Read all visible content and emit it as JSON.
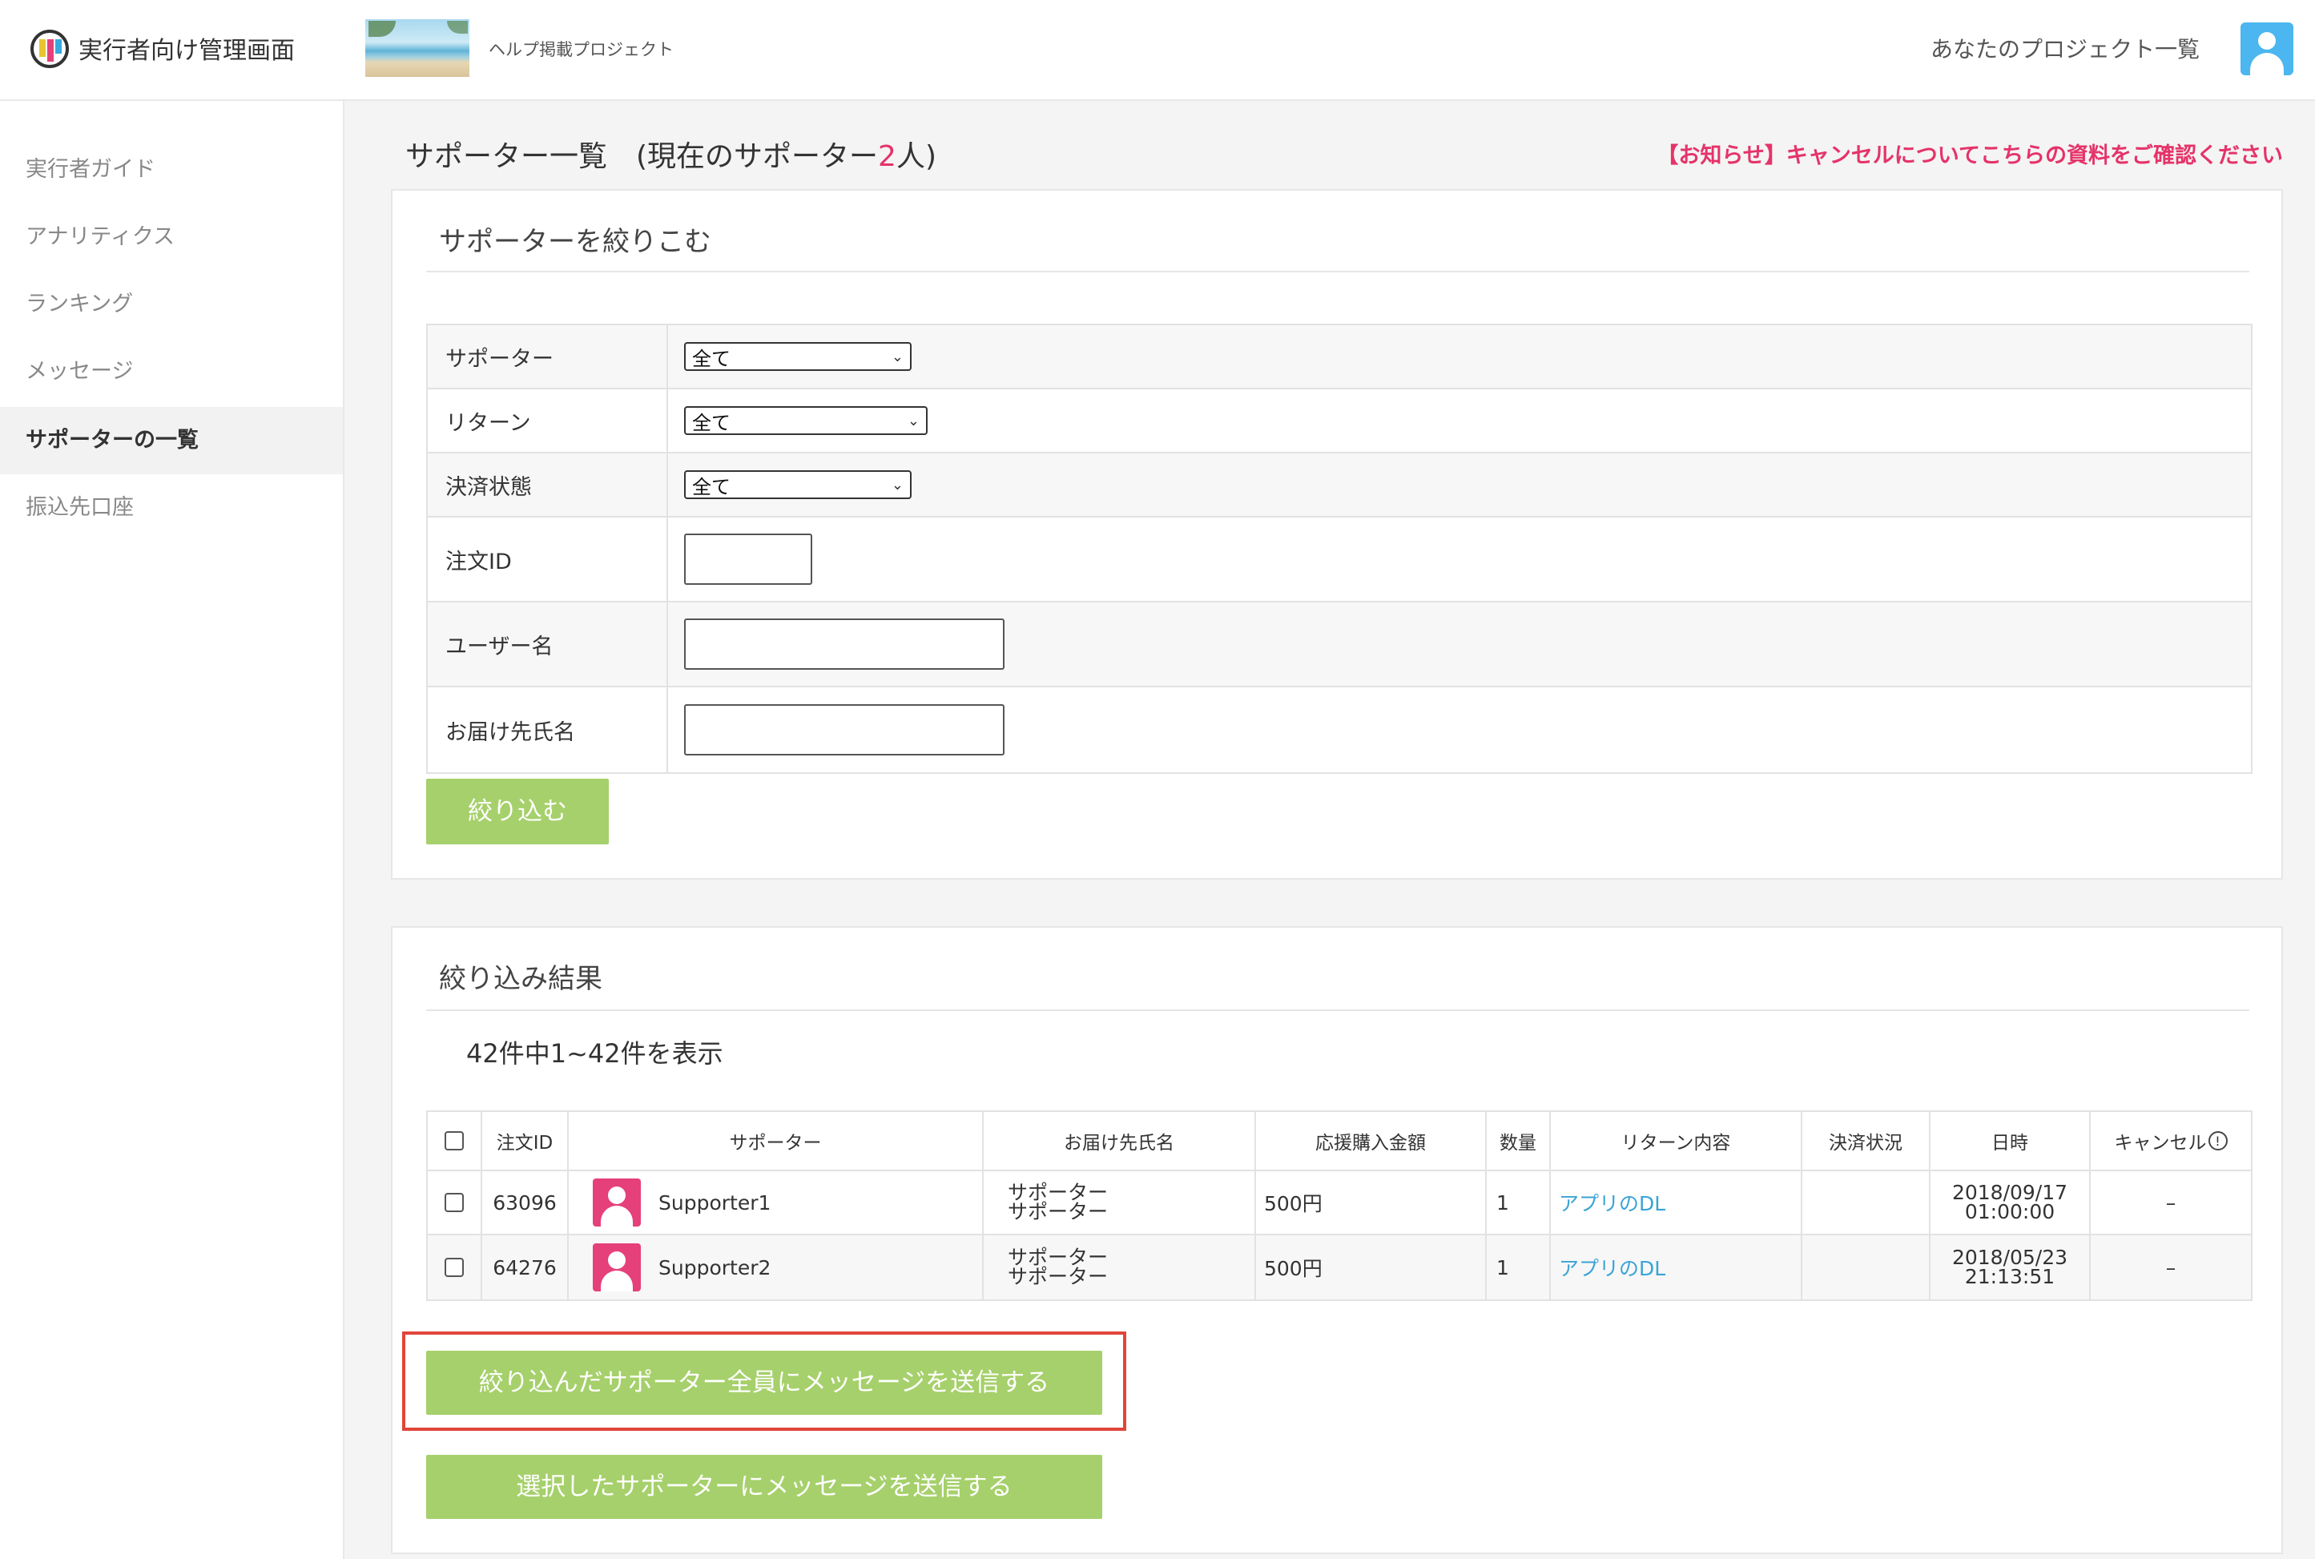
{
  "header": {
    "app_title": "実行者向け管理画面",
    "project_name": "ヘルプ掲載プロジェクト",
    "projects_link": "あなたのプロジェクト一覧"
  },
  "sidebar": {
    "items": [
      {
        "label": "実行者ガイド",
        "active": false
      },
      {
        "label": "アナリティクス",
        "active": false
      },
      {
        "label": "ランキング",
        "active": false
      },
      {
        "label": "メッセージ",
        "active": false
      },
      {
        "label": "サポーターの一覧",
        "active": true
      },
      {
        "label": "振込先口座",
        "active": false
      }
    ]
  },
  "page": {
    "title_prefix": "サポーター一覧　(現在のサポーター",
    "supporter_count": "2",
    "title_suffix": "人)",
    "notice": "【お知らせ】キャンセルについてこちらの資料をご確認ください"
  },
  "filter": {
    "title": "サポーターを絞りこむ",
    "rows": {
      "supporter": {
        "label": "サポーター",
        "value": "全て"
      },
      "return": {
        "label": "リターン",
        "value": "全て"
      },
      "payment": {
        "label": "決済状態",
        "value": "全て"
      },
      "order_id": {
        "label": "注文ID",
        "value": ""
      },
      "username": {
        "label": "ユーザー名",
        "value": ""
      },
      "recipient": {
        "label": "お届け先氏名",
        "value": ""
      }
    },
    "submit_label": "絞り込む"
  },
  "results": {
    "title": "絞り込み結果",
    "count_text": "42件中1~42件を表示",
    "columns": [
      "注文ID",
      "サポーター",
      "お届け先氏名",
      "応援購入金額",
      "数量",
      "リターン内容",
      "決済状況",
      "日時",
      "キャンセル"
    ],
    "rows": [
      {
        "order_id": "63096",
        "supporter": "Supporter1",
        "recipient_line1": "サポーター",
        "recipient_line2": "サポーター",
        "amount": "500円",
        "quantity": "1",
        "return": "アプリのDL",
        "payment_status": "",
        "date": "2018/09/17",
        "time": "01:00:00",
        "cancel": "–"
      },
      {
        "order_id": "64276",
        "supporter": "Supporter2",
        "recipient_line1": "サポーター",
        "recipient_line2": "サポーター",
        "amount": "500円",
        "quantity": "1",
        "return": "アプリのDL",
        "payment_status": "",
        "date": "2018/05/23",
        "time": "21:13:51",
        "cancel": "–"
      }
    ],
    "send_all_label": "絞り込んだサポーター全員にメッセージを送信する",
    "send_selected_label": "選択したサポーターにメッセージを送信する"
  },
  "colors": {
    "accent_green": "#a6d06b",
    "accent_pink": "#e5336a",
    "link_blue": "#3aa3d6",
    "highlight_red": "#e1453a"
  }
}
